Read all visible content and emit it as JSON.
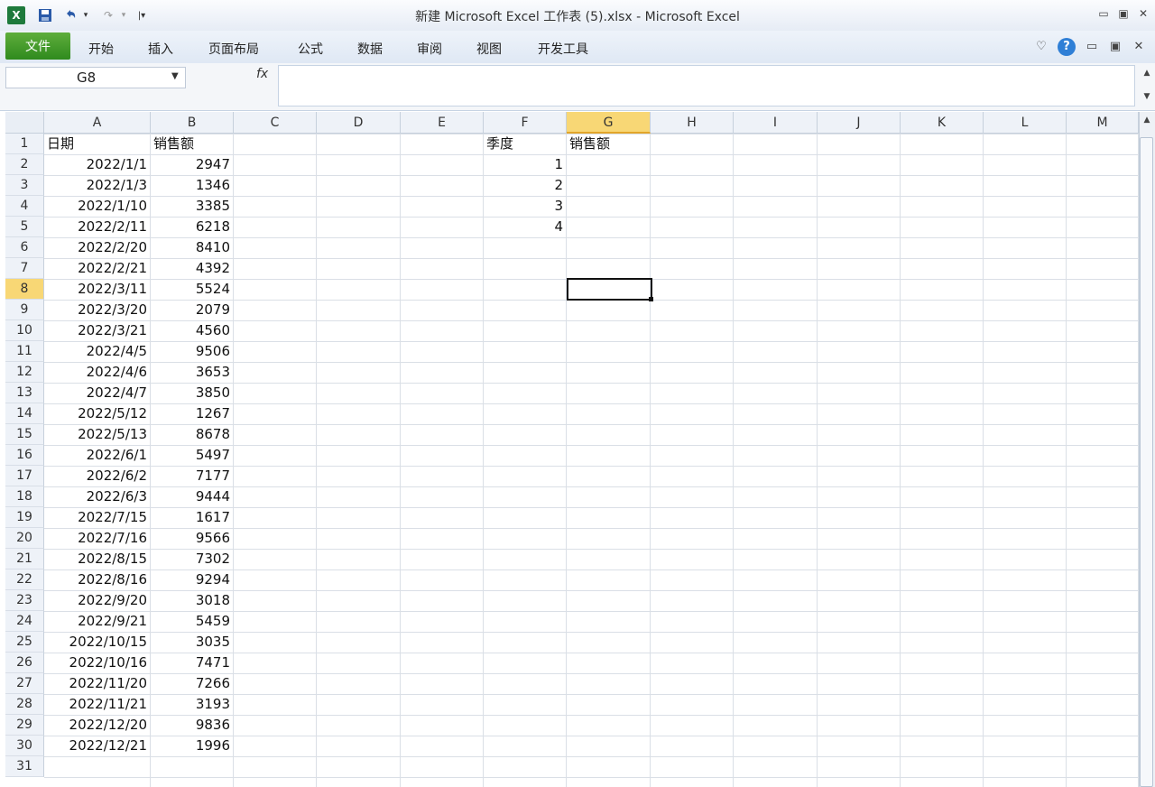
{
  "window": {
    "title": "新建 Microsoft Excel 工作表 (5).xlsx - Microsoft Excel",
    "app_icon": "excel-icon",
    "quick_access": [
      "save-icon",
      "undo-icon",
      "redo-icon",
      "customize-icon"
    ],
    "controls": [
      "minimize-icon",
      "restore-icon",
      "close-icon"
    ]
  },
  "ribbon": {
    "file_tab": "文件",
    "tabs": [
      "开始",
      "插入",
      "页面布局",
      "公式",
      "数据",
      "审阅",
      "视图",
      "开发工具"
    ],
    "right_icons": [
      "ribbon-minimize-icon",
      "help-icon",
      "doc-minimize-icon",
      "doc-restore-icon",
      "doc-close-icon"
    ]
  },
  "formula_bar": {
    "name_box": "G8",
    "fx_label": "fx",
    "formula": ""
  },
  "sheet": {
    "columns": [
      "A",
      "B",
      "C",
      "D",
      "E",
      "F",
      "G",
      "H",
      "I",
      "J",
      "K",
      "L",
      "M"
    ],
    "row_numbers": [
      "1",
      "2",
      "3",
      "4",
      "5",
      "6",
      "7",
      "8",
      "9",
      "10",
      "11",
      "12",
      "13",
      "14",
      "15",
      "16",
      "17",
      "18",
      "19",
      "20",
      "21",
      "22",
      "23",
      "24",
      "25",
      "26",
      "27",
      "28",
      "29",
      "30",
      "31"
    ],
    "active_cell": "G8",
    "header_A": "日期",
    "header_B": "销售额",
    "header_F": "季度",
    "header_G": "销售额",
    "dates": [
      "2022/1/1",
      "2022/1/3",
      "2022/1/10",
      "2022/2/11",
      "2022/2/20",
      "2022/2/21",
      "2022/3/11",
      "2022/3/20",
      "2022/3/21",
      "2022/4/5",
      "2022/4/6",
      "2022/4/7",
      "2022/5/12",
      "2022/5/13",
      "2022/6/1",
      "2022/6/2",
      "2022/6/3",
      "2022/7/15",
      "2022/7/16",
      "2022/8/15",
      "2022/8/16",
      "2022/9/20",
      "2022/9/21",
      "2022/10/15",
      "2022/10/16",
      "2022/11/20",
      "2022/11/21",
      "2022/12/20",
      "2022/12/21"
    ],
    "sales": [
      "2947",
      "1346",
      "3385",
      "6218",
      "8410",
      "4392",
      "5524",
      "2079",
      "4560",
      "9506",
      "3653",
      "3850",
      "1267",
      "8678",
      "5497",
      "7177",
      "9444",
      "1617",
      "9566",
      "7302",
      "9294",
      "3018",
      "5459",
      "3035",
      "7471",
      "7266",
      "3193",
      "9836",
      "1996"
    ],
    "quarters": [
      "1",
      "2",
      "3",
      "4"
    ]
  }
}
